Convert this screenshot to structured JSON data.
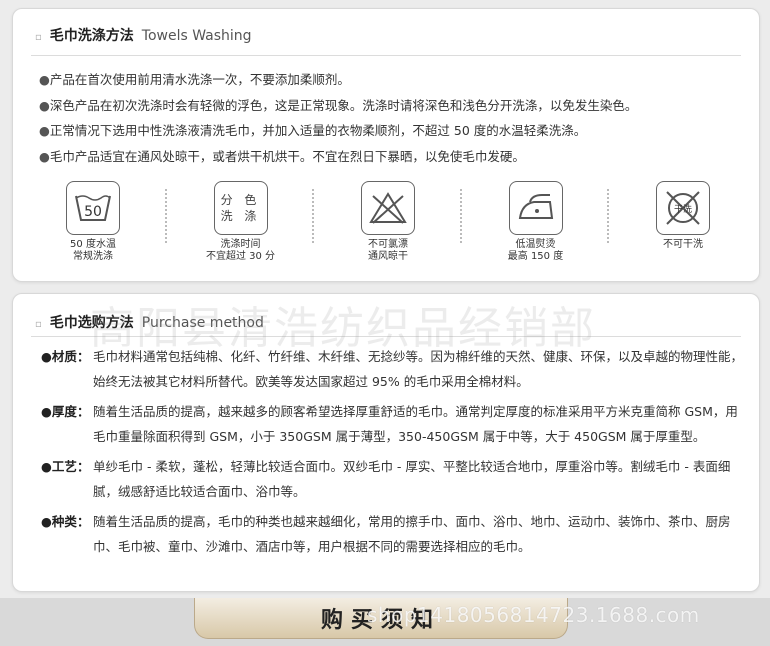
{
  "wash": {
    "title_cn": "毛巾洗涤方法",
    "title_en": "Towels Washing",
    "bullets": [
      "产品在首次使用前用清水洗涤一次，不要添加柔顺剂。",
      "深色产品在初次洗涤时会有轻微的浮色，这是正常现象。洗涤时请将深色和浅色分开洗涤，以免发生染色。",
      "正常情况下选用中性洗涤液清洗毛巾，并加入适量的衣物柔顺剂，不超过 50 度的水温轻柔洗涤。",
      "毛巾产品适宜在通风处晾干，或者烘干机烘干。不宜在烈日下暴晒，以免使毛巾发硬。"
    ],
    "care_icons": [
      {
        "icon": "wash-50-icon",
        "symbol": "50",
        "caption": "50 度水温\n常规洗涤"
      },
      {
        "icon": "wash-separately-icon",
        "symbol_line1": "分 色",
        "symbol_line2": "洗 涤",
        "caption": "洗涤时间\n不宜超过 30 分"
      },
      {
        "icon": "do-not-bleach-icon",
        "caption": "不可氯漂\n通风晾干"
      },
      {
        "icon": "low-iron-icon",
        "caption": "低温熨烫\n最高 150 度"
      },
      {
        "icon": "do-not-dryclean-icon",
        "symbol": "干洗",
        "caption": "不可干洗"
      }
    ]
  },
  "buy": {
    "title_cn": "毛巾选购方法",
    "title_en": "Purchase method",
    "watermark": "高阳县清浩纺织品经销部",
    "items": [
      {
        "label": "材质",
        "text": "毛巾材料通常包括纯棉、化纤、竹纤维、木纤维、无捻纱等。因为棉纤维的天然、健康、环保，以及卓越的物理性能，始终无法被其它材料所替代。欧美等发达国家超过 95% 的毛巾采用全棉材料。"
      },
      {
        "label": "厚度",
        "text": "随着生活品质的提高，越来越多的顾客希望选择厚重舒适的毛巾。通常判定厚度的标准采用平方米克重简称 GSM，用毛巾重量除面积得到 GSM，小于 350GSM 属于薄型，350-450GSM 属于中等，大于 450GSM 属于厚重型。"
      },
      {
        "label": "工艺",
        "text": "单纱毛巾 - 柔软，蓬松，轻薄比较适合面巾。双纱毛巾 - 厚实、平整比较适合地巾，厚重浴巾等。割绒毛巾 - 表面细腻，绒感舒适比较适合面巾、浴巾等。"
      },
      {
        "label": "种类",
        "text": "随着生活品质的提高，毛巾的种类也越来越细化，常用的擦手巾、面巾、浴巾、地巾、运动巾、装饰巾、茶巾、厨房巾、毛巾被、童巾、沙滩巾、酒店巾等，用户根据不同的需要选择相应的毛巾。"
      }
    ]
  },
  "footer": {
    "notice_title": "购买须知",
    "url_watermark": "shop1418056814723.1688.com"
  }
}
